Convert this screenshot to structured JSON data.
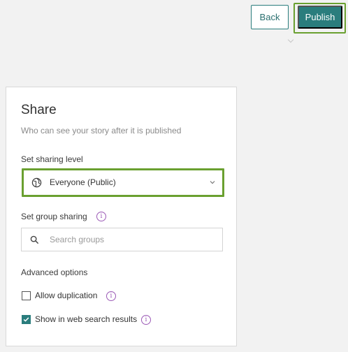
{
  "toolbar": {
    "back_label": "Back",
    "publish_label": "Publish"
  },
  "share_panel": {
    "title": "Share",
    "subtitle": "Who can see your story after it is published",
    "sharing_level": {
      "label": "Set sharing level",
      "selected_value": "Everyone (Public)",
      "icon": "globe-icon"
    },
    "group_sharing": {
      "label": "Set group sharing",
      "search_placeholder": "Search groups",
      "search_value": ""
    },
    "advanced": {
      "label": "Advanced options",
      "options": [
        {
          "label": "Allow duplication",
          "checked": false
        },
        {
          "label": "Show in web search results",
          "checked": true
        }
      ]
    }
  },
  "colors": {
    "accent": "#2a7d7d",
    "highlight": "#6aa030",
    "info": "#9b59b6"
  }
}
